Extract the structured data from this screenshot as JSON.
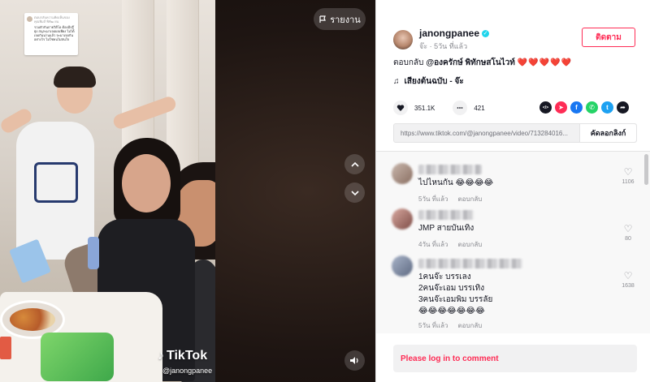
{
  "video": {
    "report_label": "รายงาน",
    "watermark_brand": "TikTok",
    "watermark_user": "@janongpanee",
    "caption_card": {
      "header": "ตอบกลับความคิดเห็นของ คุณพิมส์ พิทัฒ ยน",
      "body": "รวมตัวกันถ่ายวิดีโอ ต้องมีปรู๊ยุ่ง สนุกๆมาเจอผลเพียง ไม่ได้เจอกันนานแล้ว จะมาเจอกันอย่างไร ไม่ใช่คนไม่สนใจ"
    }
  },
  "author": {
    "username": "janongpanee",
    "display_name": "จ๊ะ",
    "time_ago": "5วัน ที่แล้ว",
    "follow_label": "ติดตาม"
  },
  "post": {
    "reply_prefix": "ตอบกลับ",
    "mention": "@องครักษ์ พิทักษสโนไวท์",
    "hearts": "❤️❤️❤️❤️❤️",
    "sound": "เสียงต้นฉบับ - จ๊ะ",
    "likes": "351.1K",
    "comments_count": "421",
    "link": "https://www.tiktok.com/@janongpanee/video/713284016...",
    "copy_link_label": "คัดลอกลิงก์"
  },
  "share_icons": [
    {
      "name": "embed-icon",
      "color": "#161823",
      "glyph": "</>"
    },
    {
      "name": "send-icon",
      "color": "#fe2c55",
      "glyph": "➤"
    },
    {
      "name": "facebook-icon",
      "color": "#1877f2",
      "glyph": "f"
    },
    {
      "name": "whatsapp-icon",
      "color": "#25d366",
      "glyph": "✆"
    },
    {
      "name": "twitter-icon",
      "color": "#1da1f2",
      "glyph": "t"
    },
    {
      "name": "share-arrow-icon",
      "color": "#161823",
      "glyph": "➦"
    }
  ],
  "comments": [
    {
      "text": "ไปไหนกัน 😂😂😂😂",
      "time": "5วัน ที่แล้ว",
      "reply": "ตอบกลับ",
      "likes": "1106"
    },
    {
      "text": "JMP สายบันเทิง",
      "time": "4วัน ที่แล้ว",
      "reply": "ตอบกลับ",
      "likes": "80"
    },
    {
      "text": "1คนจ๊ะ บรรเลง\n2คนจ๊ะเอม บรรเทิง\n3คนจ๊ะเอมพิม บรรลัย\n😂😂😂😂😂😂😂",
      "time": "5วัน ที่แล้ว",
      "reply": "ตอบกลับ",
      "likes": "1638"
    }
  ],
  "login_prompt": "Please log in to comment"
}
